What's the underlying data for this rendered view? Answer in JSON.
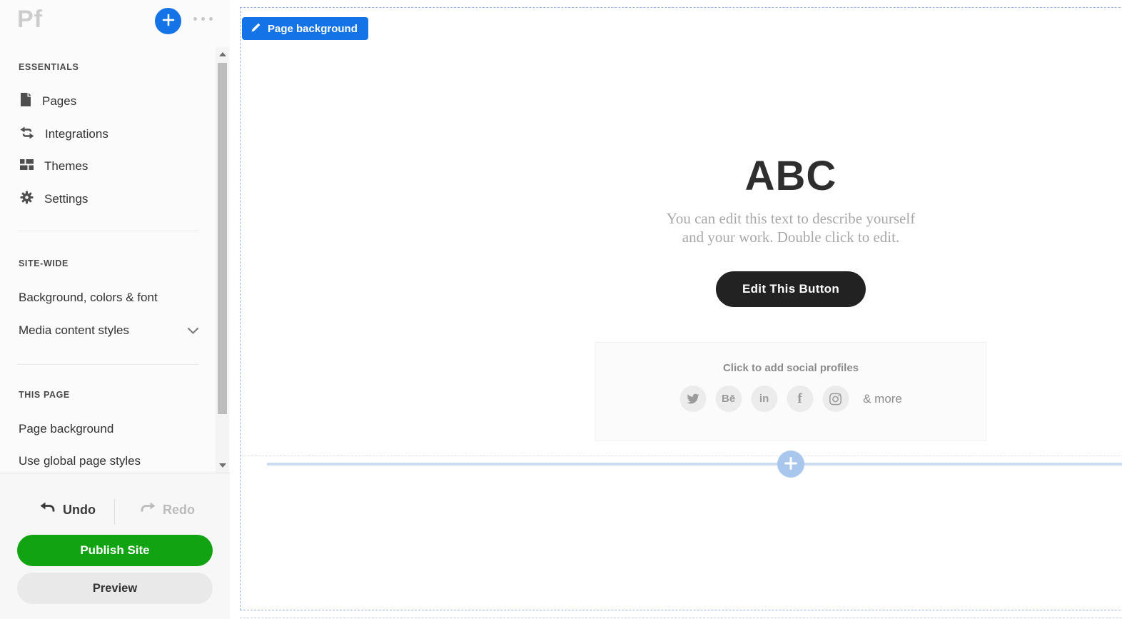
{
  "sidebar": {
    "logo": "Pf",
    "sections": {
      "essentials": {
        "title": "ESSENTIALS",
        "items": {
          "pages": "Pages",
          "integrations": "Integrations",
          "themes": "Themes",
          "settings": "Settings"
        }
      },
      "sitewide": {
        "title": "SITE-WIDE",
        "items": {
          "background": "Background, colors & font",
          "media": "Media content styles"
        }
      },
      "thispage": {
        "title": "THIS PAGE",
        "items": {
          "pagebg": "Page background",
          "global": "Use global page styles"
        }
      }
    },
    "footer": {
      "undo": "Undo",
      "redo": "Redo",
      "publish": "Publish Site",
      "preview": "Preview"
    }
  },
  "canvas": {
    "tag_label": "Page background",
    "hero": {
      "title": "ABC",
      "subtitle_lines": [
        "You can edit this text to describe yourself",
        "and your work. Double click to edit."
      ],
      "button_label": "Edit This Button"
    },
    "social": {
      "title": "Click to add social profiles",
      "behance_glyph": "Bē",
      "linkedin_glyph": "in",
      "facebook_glyph": "f",
      "more_label": "& more"
    }
  },
  "colors": {
    "accent_blue": "#1473e6",
    "publish_green": "#12a312",
    "edit_button_black": "#222222",
    "dashed_border_blue": "#93b5e8",
    "add_line_blue": "#ccdcf0"
  }
}
